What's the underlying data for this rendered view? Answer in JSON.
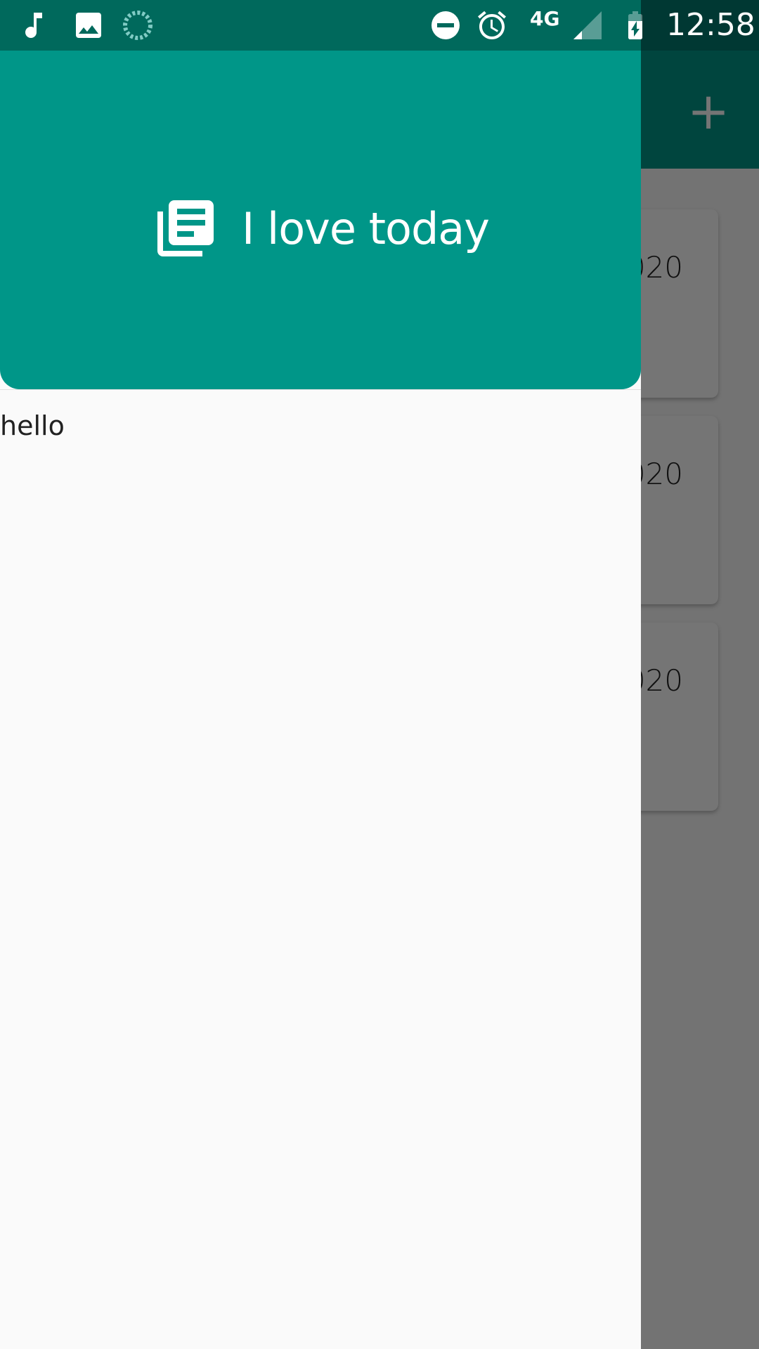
{
  "status_bar": {
    "time": "12:58",
    "network_label": "4G",
    "icons": [
      "music-note-icon",
      "image-icon",
      "sync-progress-icon",
      "do-not-disturb-icon",
      "alarm-icon",
      "signal-icon",
      "battery-charging-icon"
    ]
  },
  "app_bar": {
    "action_icon": "plus-icon",
    "action_symbol": "+"
  },
  "background_list": {
    "items": [
      {
        "partial_text": "020"
      },
      {
        "partial_text": "020"
      },
      {
        "partial_text": "020"
      }
    ]
  },
  "drawer": {
    "header": {
      "icon": "library-books-icon",
      "title": "I love today"
    },
    "items": [
      {
        "label": "hello"
      }
    ]
  },
  "colors": {
    "primary": "#009688",
    "primary_dark": "#00695c",
    "drawer_background": "#fafafa",
    "scrim": "rgba(0,0,0,0.54)"
  }
}
